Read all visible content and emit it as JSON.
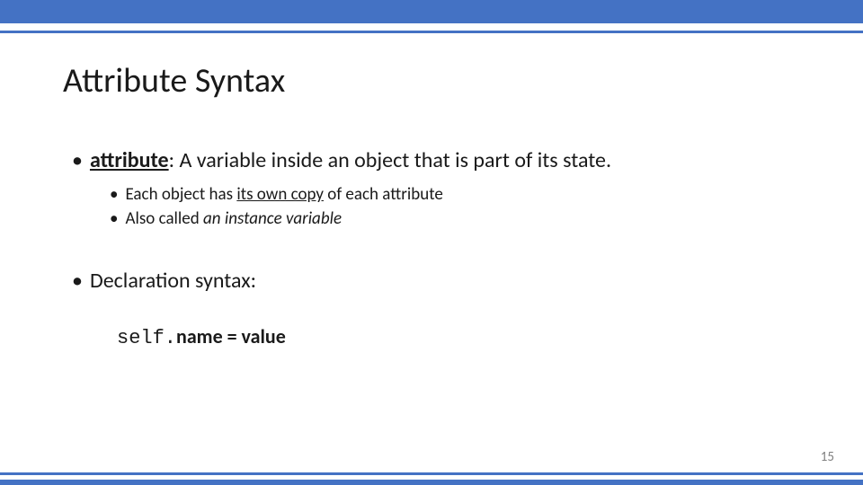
{
  "title": "Attribute Syntax",
  "bullets": {
    "main1": {
      "term": "attribute",
      "definition": ": A variable inside an object that is part of its state."
    },
    "sub1_prefix": "Each object has ",
    "sub1_underlined": "its own copy",
    "sub1_suffix": " of each attribute",
    "sub2_prefix": "Also called ",
    "sub2_italic": "an instance variable",
    "main2": "Declaration syntax:",
    "code_mono": "self.",
    "code_bold": "name = value"
  },
  "pageNumber": "15"
}
